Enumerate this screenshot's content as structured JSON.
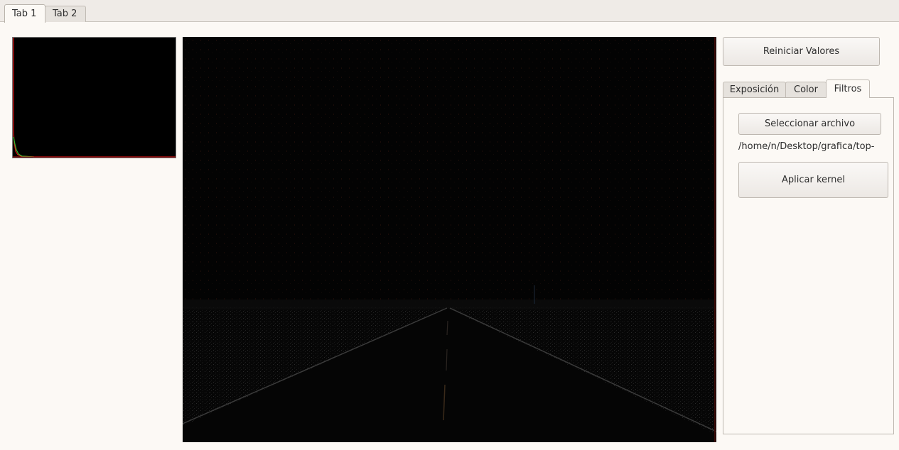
{
  "tabs": [
    {
      "label": "Tab 1",
      "active": true
    },
    {
      "label": "Tab 2",
      "active": false
    }
  ],
  "controls": {
    "reset_label": "Reiniciar Valores",
    "subtabs": [
      {
        "label": "Exposición",
        "active": false
      },
      {
        "label": "Color",
        "active": false
      },
      {
        "label": "Filtros",
        "active": true
      }
    ],
    "filters": {
      "select_file_label": "Seleccionar archivo",
      "file_path": "/home/n/Desktop/grafica/top-gra",
      "apply_kernel_label": "Aplicar kernel"
    }
  },
  "histogram": {
    "background": "#000000",
    "series_colors": [
      "#ff2020",
      "#20c020"
    ]
  },
  "image_view": {
    "description_icon": "road-edge-filtered-image"
  }
}
